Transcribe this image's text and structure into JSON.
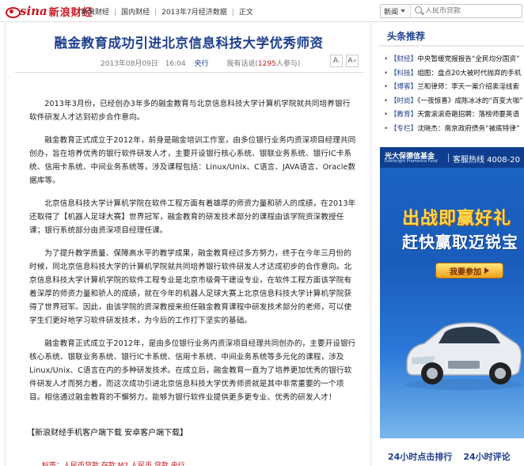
{
  "header": {
    "logo_sina": "sina",
    "logo_finance": "新浪财经",
    "breadcrumbs": [
      "新浪财经",
      "国内财经",
      "2013年7月经济数据",
      "正文"
    ],
    "search": {
      "category": "新闻",
      "placeholder": "人民币贷款"
    }
  },
  "article": {
    "title": "融金教育成功引进北京信息科技大学优秀师资",
    "date": "2013年08月09日",
    "time": "16:04",
    "source": "央行",
    "comment_prefix": "我有话说(",
    "comment_count": "1295",
    "comment_suffix": "人参与)",
    "font_smaller": "A",
    "font_larger": "A",
    "paragraphs": [
      "2013年3月份，已经创办3年多的融金教育与北京信息科技大学计算机学院就共同培养银行软件研发人才达到初步合作意向。",
      "融金教育正式成立于2012年，前身是融金培训工作室，由多位银行业务内资深项目经理共同创办，旨在培养优秀的银行软件研发人才，主要开设银行核心系统、银联业务系统、银行IC卡系统、信用卡系统、中间业务系统等，涉及课程包括：Linux/Unix、C语言、JAVA语言、Oracle数据库等。",
      "北京信息科技大学计算机学院在软件工程方面有着雄厚的师资力量和骄人的成绩，在2013年还取得了【机器人足球大赛】世界冠军，融金教育的研发技术部分的课程由该学院资深教授任课；银行系统部分由资深项目经理任课。",
      "为了提升教学质量、保障高水平的教学成果，融金教育经过多方努力，终于在今年三月份的时候，同北京信息科技大学的计算机学院就共同培养银行软件研发人才达成初步的合作意向。北京信息科技大学计算机学院的软件工程专业是北京市级骨干建设专业，在软件工程方面该学院有着深厚的师资力量和骄人的成绩，就在今年的机器人足球大赛上北京信息科技大学计算机学院获得了世界冠军。因此，由该学院的资深教授来担任融金教育课程中研发技术部分的老师，可以使学生们更好地学习软件研发技术，为今后的工作打下坚实的基础。",
      "融金教育正式成立于2012年，是由多位银行业务内资深项目经理共同创办的，主要开设银行核心系统、银联业务系统、银行IC卡系统、信用卡系统、中间业务系统等多元化的课程，涉及Linux/Unix、C语言在内的多种研发技术。在成立后，融金教育一直为了培养更加优秀的银行软件研发人才而努力着，而这次成功引进北京信息科技大学优秀师资就是其中非常重要的一个项目。相信通过融金教育的不懈努力，能够为银行软件业提供更多更专业、优秀的研发人才！"
    ],
    "download_text": "【新浪财经手机客户端下载 安卓客户端下载】",
    "tags": "标签：人民币贷款  存款  M2  人民币  贷款  央行"
  },
  "sidebar": {
    "headline_title": "头条推荐",
    "news": [
      {
        "cat": "【财经】",
        "text": "中央暂缓党报报告“全民均分国资”"
      },
      {
        "cat": "【科技】",
        "text": "组图：盘点20大被时代抛弃的手机"
      },
      {
        "cat": "【博客】",
        "text": "兰和律师：李天一案介绍卖淫线索"
      },
      {
        "cat": "【时尚】",
        "text": "《一夜惊喜》成陈冰冰的“百变大咖”"
      },
      {
        "cat": "【教育】",
        "text": "天雷滚滚奇葩招聘：落榜师要英语"
      },
      {
        "cat": "【专栏】",
        "text": "沈晓杰：南京政府债务“被底特律”"
      }
    ],
    "ad": {
      "brand": "光大保德信基金",
      "brand_en": "Everbright Pramerica Fund",
      "hotline": "客服热线 4008-20",
      "headline1": "出战即赢好礼",
      "headline2": "赶快赢取迈锐宝",
      "join_label": "我要参加"
    },
    "bottom_tabs": [
      "24小时点击排行",
      "24小时评论"
    ]
  },
  "colors": {
    "brand_red": "#c8161d",
    "title_blue": "#1f3f8f",
    "ad_blue": "#1b63c5"
  }
}
